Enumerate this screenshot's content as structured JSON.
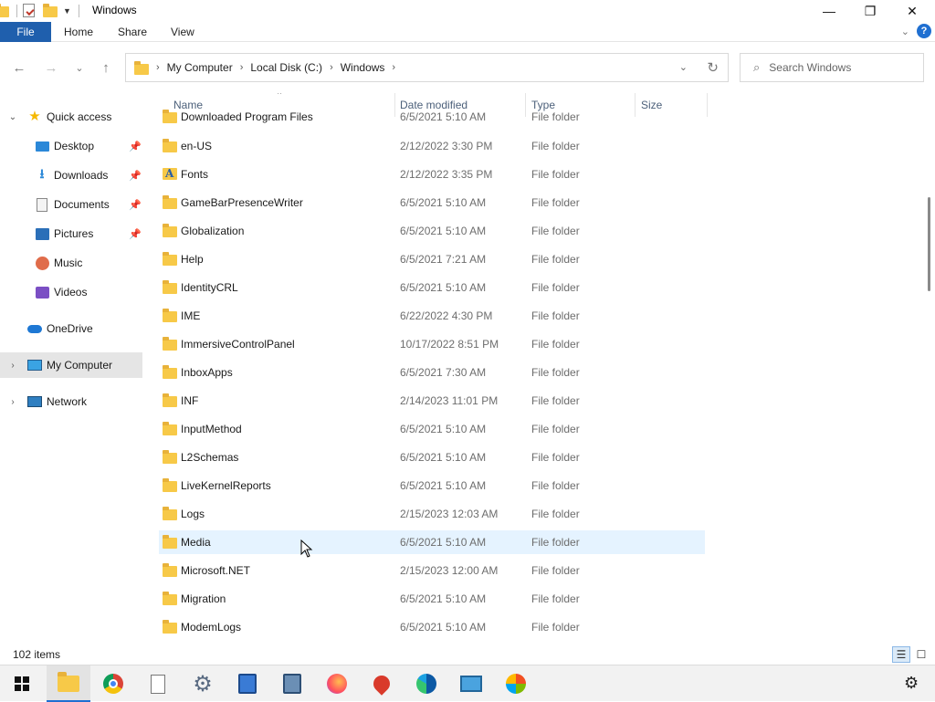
{
  "window": {
    "title": "Windows",
    "minimize_glyph": "—",
    "maximize_glyph": "❐",
    "close_glyph": "✕"
  },
  "ribbon": {
    "tabs": [
      {
        "label": "File"
      },
      {
        "label": "Home"
      },
      {
        "label": "Share"
      },
      {
        "label": "View"
      }
    ],
    "help_glyph": "?",
    "expand_glyph": "⌄"
  },
  "nav_buttons": {
    "back": "←",
    "forward": "→",
    "recent": "⌄",
    "up": "↑"
  },
  "address": {
    "crumbs": [
      "My Computer",
      "Local Disk (C:)",
      "Windows"
    ],
    "separator": "›"
  },
  "search": {
    "placeholder": "Search Windows"
  },
  "sidebar": {
    "items": [
      {
        "label": "Quick access",
        "icon": "star-icon",
        "expandable": "expanded"
      },
      {
        "label": "Desktop",
        "icon": "desktop-icon",
        "pinned": true
      },
      {
        "label": "Downloads",
        "icon": "download-icon",
        "pinned": true
      },
      {
        "label": "Documents",
        "icon": "documents-icon",
        "pinned": true
      },
      {
        "label": "Pictures",
        "icon": "pictures-icon",
        "pinned": true
      },
      {
        "label": "Music",
        "icon": "music-icon"
      },
      {
        "label": "Videos",
        "icon": "videos-icon"
      },
      {
        "label": "OneDrive",
        "icon": "onedrive-icon"
      },
      {
        "label": "My Computer",
        "icon": "computer-icon",
        "expandable": "collapsed",
        "selected": true
      },
      {
        "label": "Network",
        "icon": "network-icon",
        "expandable": "collapsed"
      }
    ]
  },
  "columns": {
    "name": "Name",
    "date": "Date modified",
    "type": "Type",
    "size": "Size"
  },
  "files": [
    {
      "name": "Downloaded Program Files",
      "date": "6/5/2021 5:10 AM",
      "type": "File folder"
    },
    {
      "name": "en-US",
      "date": "2/12/2022 3:30 PM",
      "type": "File folder"
    },
    {
      "name": "Fonts",
      "date": "2/12/2022 3:35 PM",
      "type": "File folder",
      "icon": "fonts-folder-icon"
    },
    {
      "name": "GameBarPresenceWriter",
      "date": "6/5/2021 5:10 AM",
      "type": "File folder"
    },
    {
      "name": "Globalization",
      "date": "6/5/2021 5:10 AM",
      "type": "File folder"
    },
    {
      "name": "Help",
      "date": "6/5/2021 7:21 AM",
      "type": "File folder"
    },
    {
      "name": "IdentityCRL",
      "date": "6/5/2021 5:10 AM",
      "type": "File folder"
    },
    {
      "name": "IME",
      "date": "6/22/2022 4:30 PM",
      "type": "File folder"
    },
    {
      "name": "ImmersiveControlPanel",
      "date": "10/17/2022 8:51 PM",
      "type": "File folder"
    },
    {
      "name": "InboxApps",
      "date": "6/5/2021 7:30 AM",
      "type": "File folder"
    },
    {
      "name": "INF",
      "date": "2/14/2023 11:01 PM",
      "type": "File folder"
    },
    {
      "name": "InputMethod",
      "date": "6/5/2021 5:10 AM",
      "type": "File folder"
    },
    {
      "name": "L2Schemas",
      "date": "6/5/2021 5:10 AM",
      "type": "File folder"
    },
    {
      "name": "LiveKernelReports",
      "date": "6/5/2021 5:10 AM",
      "type": "File folder"
    },
    {
      "name": "Logs",
      "date": "2/15/2023 12:03 AM",
      "type": "File folder"
    },
    {
      "name": "Media",
      "date": "6/5/2021 5:10 AM",
      "type": "File folder",
      "hover": true
    },
    {
      "name": "Microsoft.NET",
      "date": "2/15/2023 12:00 AM",
      "type": "File folder"
    },
    {
      "name": "Migration",
      "date": "6/5/2021 5:10 AM",
      "type": "File folder"
    },
    {
      "name": "ModemLogs",
      "date": "6/5/2021 5:10 AM",
      "type": "File folder"
    }
  ],
  "status": {
    "item_count": "102 items"
  },
  "taskbar": {
    "items": [
      {
        "icon": "windows-start-icon"
      },
      {
        "icon": "file-explorer-icon",
        "active": true
      },
      {
        "icon": "chrome-icon"
      },
      {
        "icon": "blank-file-icon"
      },
      {
        "icon": "settings-gear-app-icon"
      },
      {
        "icon": "notepad-icon"
      },
      {
        "icon": "calculator-icon"
      },
      {
        "icon": "firefox-icon"
      },
      {
        "icon": "maps-pin-icon"
      },
      {
        "icon": "edge-icon"
      },
      {
        "icon": "remote-desktop-icon"
      },
      {
        "icon": "paint-icon"
      }
    ],
    "settings_glyph": "⚙"
  },
  "colors": {
    "file_tab": "#1f5fad",
    "hover_row": "#e5f3ff",
    "selected_nav": "#e5e5e5",
    "folder": "#f7c948",
    "header_text": "#4c607a"
  }
}
